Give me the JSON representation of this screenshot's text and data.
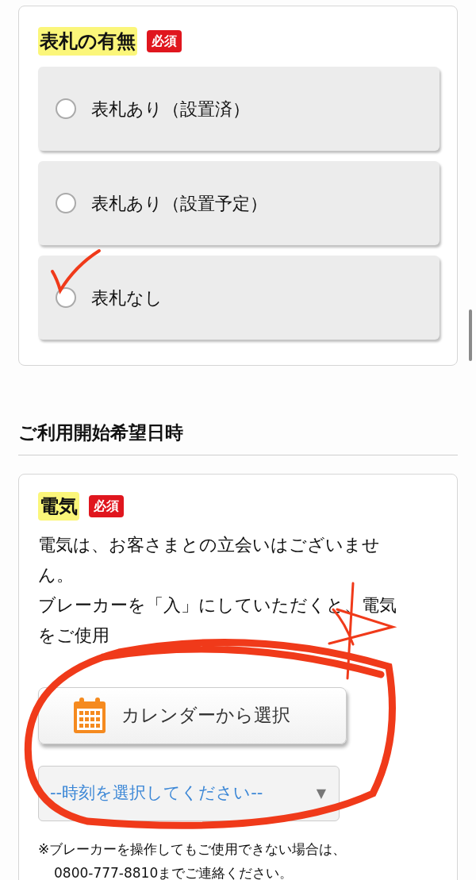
{
  "nameplate": {
    "title": "表札の有無",
    "highlighted": true,
    "badge": "必須",
    "options": [
      {
        "label": "表札あり（設置済）",
        "selected": false
      },
      {
        "label": "表札あり（設置予定）",
        "selected": false
      },
      {
        "label": "表札なし",
        "selected": false
      }
    ]
  },
  "start_date": {
    "heading": "ご利用開始希望日時",
    "electricity": {
      "title": "電気",
      "highlighted": true,
      "badge": "必須",
      "description": [
        "電気は、お客さまとの立会いはございませ",
        "ん。",
        "ブレーカーを「入」にしていただくと、電気",
        "をご使用"
      ],
      "calendar_button": "カレンダーから選択",
      "time_select": {
        "value": "--時刻を選択してください--",
        "arrow": "▼"
      },
      "note": [
        "※ブレーカーを操作してもご使用できない場合は、",
        "0800-777-8810までご連絡ください。"
      ]
    }
  },
  "annotations": [
    {
      "kind": "check"
    },
    {
      "kind": "star"
    },
    {
      "kind": "circle"
    }
  ]
}
